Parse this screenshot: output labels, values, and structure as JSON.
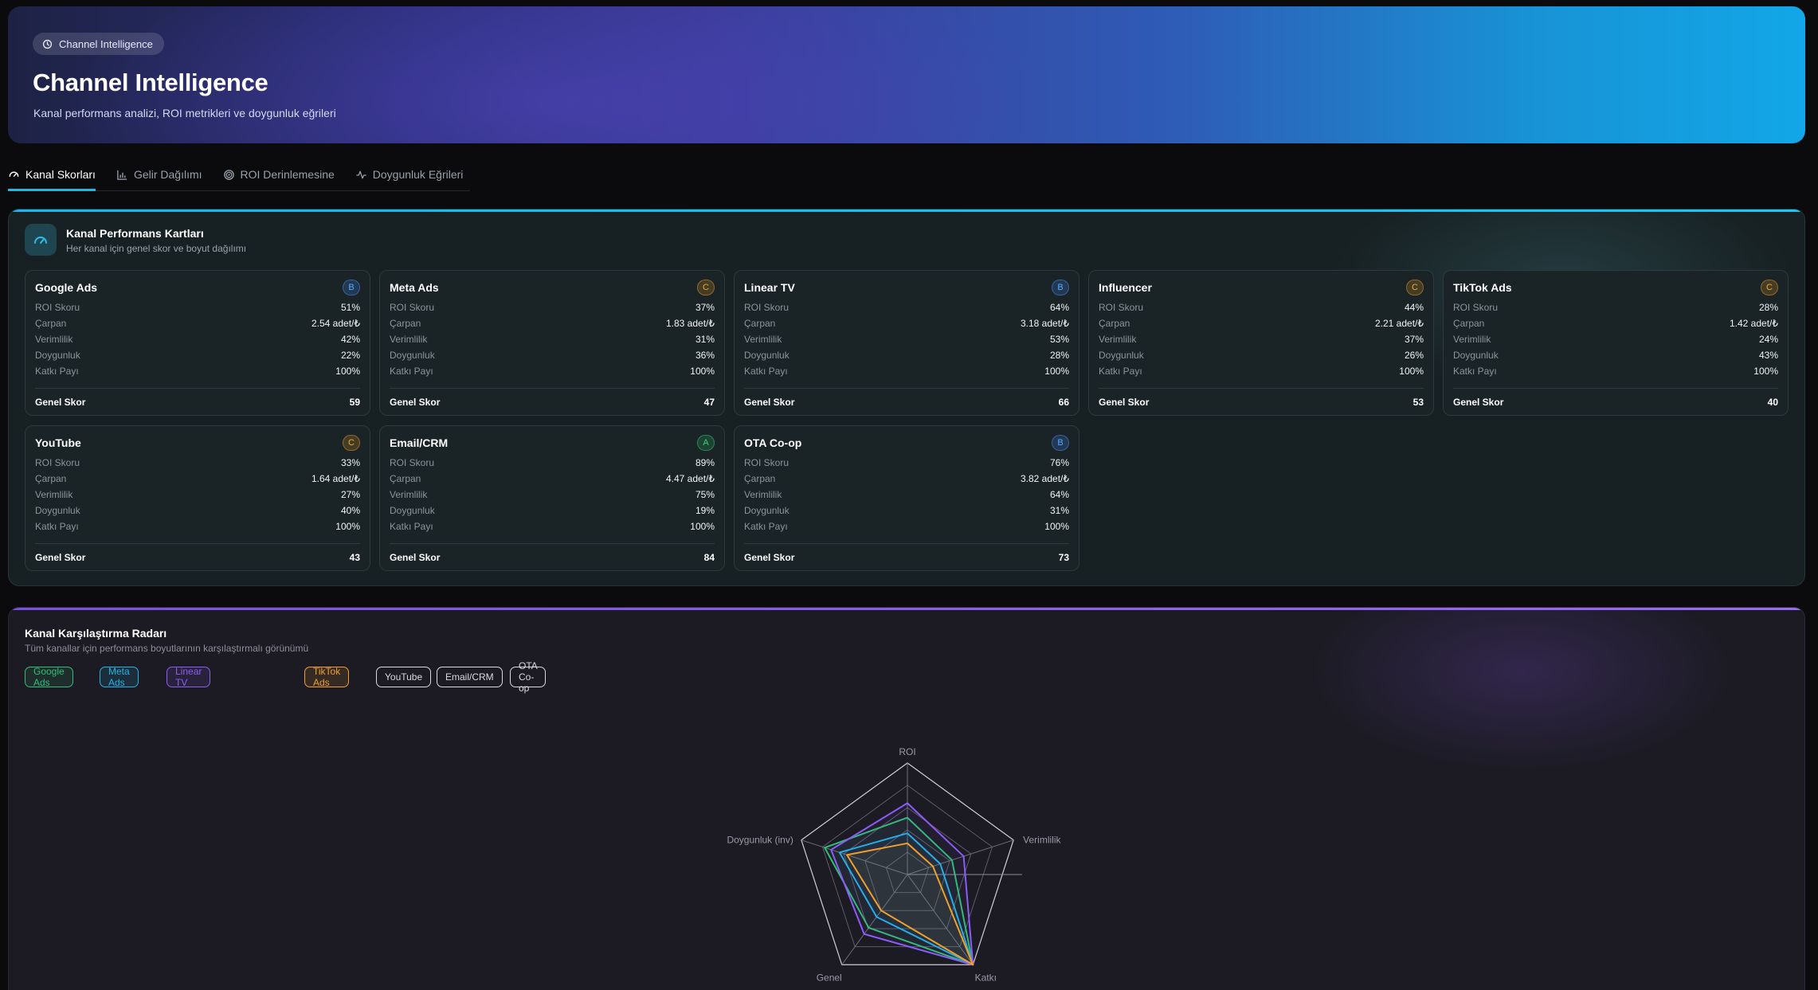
{
  "hero": {
    "badge": "Channel Intelligence",
    "title": "Channel Intelligence",
    "subtitle": "Kanal performans analizi, ROI metrikleri ve doygunluk eğrileri"
  },
  "tabs": [
    {
      "label": "Kanal Skorları",
      "icon": "gauge-icon",
      "active": true
    },
    {
      "label": "Gelir Dağılımı",
      "icon": "bar-chart-icon",
      "active": false
    },
    {
      "label": "ROI Derinlemesine",
      "icon": "target-icon",
      "active": false
    },
    {
      "label": "Doygunluk Eğrileri",
      "icon": "activity-icon",
      "active": false
    }
  ],
  "cards_panel": {
    "title": "Kanal Performans Kartları",
    "subtitle": "Her kanal için genel skor ve boyut dağılımı",
    "labels": {
      "roi": "ROI Skoru",
      "multiplier": "Çarpan",
      "efficiency": "Verimlilik",
      "saturation": "Doygunluk",
      "contribution": "Katkı Payı",
      "overall": "Genel Skor"
    },
    "cards": [
      {
        "name": "Google Ads",
        "grade": "B",
        "roi": "51%",
        "multiplier": "2.54 adet/₺",
        "efficiency": "42%",
        "saturation": "22%",
        "contribution": "100%",
        "overall": "59"
      },
      {
        "name": "Meta Ads",
        "grade": "C",
        "roi": "37%",
        "multiplier": "1.83 adet/₺",
        "efficiency": "31%",
        "saturation": "36%",
        "contribution": "100%",
        "overall": "47"
      },
      {
        "name": "Linear TV",
        "grade": "B",
        "roi": "64%",
        "multiplier": "3.18 adet/₺",
        "efficiency": "53%",
        "saturation": "28%",
        "contribution": "100%",
        "overall": "66"
      },
      {
        "name": "Influencer",
        "grade": "C",
        "roi": "44%",
        "multiplier": "2.21 adet/₺",
        "efficiency": "37%",
        "saturation": "26%",
        "contribution": "100%",
        "overall": "53"
      },
      {
        "name": "TikTok Ads",
        "grade": "C",
        "roi": "28%",
        "multiplier": "1.42 adet/₺",
        "efficiency": "24%",
        "saturation": "43%",
        "contribution": "100%",
        "overall": "40"
      },
      {
        "name": "YouTube",
        "grade": "C",
        "roi": "33%",
        "multiplier": "1.64 adet/₺",
        "efficiency": "27%",
        "saturation": "40%",
        "contribution": "100%",
        "overall": "43"
      },
      {
        "name": "Email/CRM",
        "grade": "A",
        "roi": "89%",
        "multiplier": "4.47 adet/₺",
        "efficiency": "75%",
        "saturation": "19%",
        "contribution": "100%",
        "overall": "84"
      },
      {
        "name": "OTA Co-op",
        "grade": "B",
        "roi": "76%",
        "multiplier": "3.82 adet/₺",
        "efficiency": "64%",
        "saturation": "31%",
        "contribution": "100%",
        "overall": "73"
      }
    ]
  },
  "radar_panel": {
    "title": "Kanal Karşılaştırma Radarı",
    "subtitle": "Tüm kanallar için performans boyutlarının karşılaştırmalı görünümü",
    "chips": [
      {
        "label": "Google Ads",
        "color": "#2fbf74",
        "selected": true
      },
      {
        "label": "Meta Ads",
        "color": "#22b3e6",
        "selected": true
      },
      {
        "label": "Linear TV",
        "color": "#8b5cf6",
        "selected": true
      },
      {
        "label": "TikTok Ads",
        "color": "#f0a02a",
        "selected": true
      },
      {
        "label": "YouTube",
        "color": "#d8d8de",
        "selected": false
      },
      {
        "label": "Email/CRM",
        "color": "#d8d8de",
        "selected": false
      },
      {
        "label": "OTA Co-op",
        "color": "#d8d8de",
        "selected": false
      }
    ]
  },
  "chart_data": {
    "type": "radar",
    "axes": [
      "ROI",
      "Verimlilik",
      "Katkı",
      "Genel",
      "Doygunluk (inv)"
    ],
    "range": [
      0,
      100
    ],
    "grid_levels": 5,
    "series": [
      {
        "name": "Google Ads",
        "color": "#2fbf74",
        "values": [
          51,
          42,
          100,
          59,
          78
        ]
      },
      {
        "name": "Meta Ads",
        "color": "#22b3e6",
        "values": [
          37,
          31,
          100,
          47,
          64
        ]
      },
      {
        "name": "Linear TV",
        "color": "#8b5cf6",
        "values": [
          64,
          53,
          100,
          66,
          72
        ]
      },
      {
        "name": "TikTok Ads",
        "color": "#f0a02a",
        "values": [
          28,
          24,
          100,
          40,
          57
        ]
      }
    ]
  }
}
